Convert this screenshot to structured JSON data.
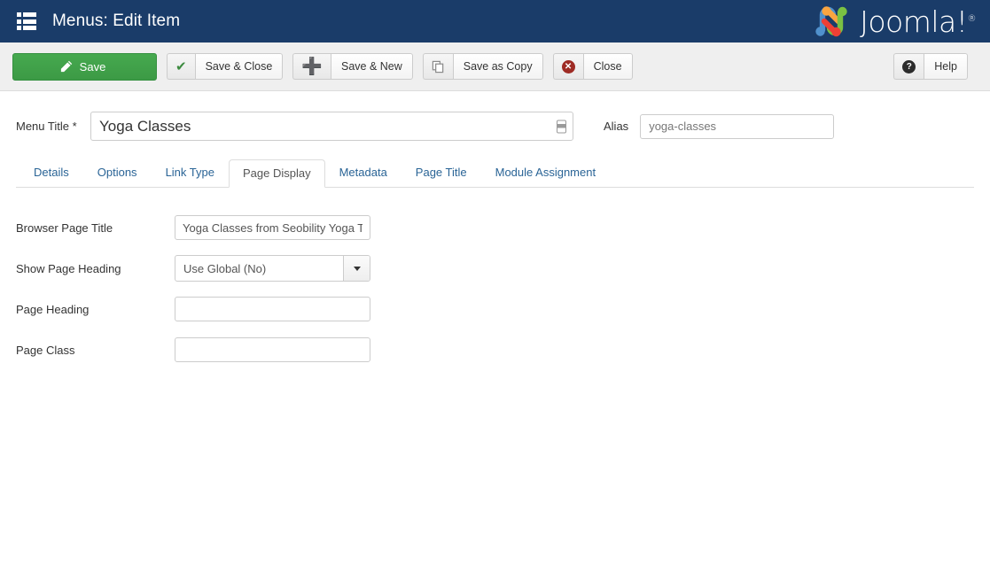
{
  "header": {
    "title": "Menus: Edit Item",
    "menu_icon": "grid-menu-icon",
    "brand": "Joomla!",
    "brand_reg": "®",
    "bg_color": "#1a3c69"
  },
  "toolbar": {
    "save_label": "Save",
    "save_icon": "edit-pencil-icon",
    "save_color": "#3c9a45",
    "save_close_label": "Save & Close",
    "save_close_icon": "check-icon",
    "save_new_label": "Save & New",
    "save_new_icon": "plus-icon",
    "save_copy_label": "Save as Copy",
    "save_copy_icon": "copy-pages-icon",
    "close_label": "Close",
    "close_icon": "circle-x-icon",
    "help_label": "Help",
    "help_icon": "circle-question-icon"
  },
  "title_row": {
    "menu_title_label": "Menu Title *",
    "menu_title_value": "Yoga Classes",
    "autofill_icon": "autofill-indicator-icon",
    "alias_label": "Alias",
    "alias_value": "yoga-classes"
  },
  "tabs": [
    {
      "label": "Details",
      "active": false
    },
    {
      "label": "Options",
      "active": false
    },
    {
      "label": "Link Type",
      "active": false
    },
    {
      "label": "Page Display",
      "active": true
    },
    {
      "label": "Metadata",
      "active": false
    },
    {
      "label": "Page Title",
      "active": false
    },
    {
      "label": "Module Assignment",
      "active": false
    }
  ],
  "form": {
    "browser_page_title_label": "Browser Page Title",
    "browser_page_title_value": "Yoga Classes from Seobility Yoga Temple",
    "show_page_heading_label": "Show Page Heading",
    "show_page_heading_value": "Use Global (No)",
    "page_heading_label": "Page Heading",
    "page_heading_value": "",
    "page_class_label": "Page Class",
    "page_class_value": ""
  }
}
